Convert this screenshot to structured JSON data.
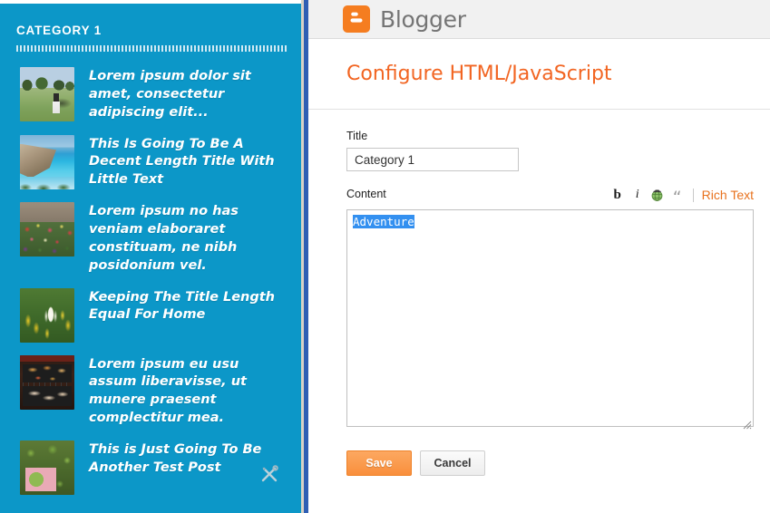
{
  "sidebar": {
    "category_title": "CATEGORY 1",
    "tools_icon": "tools-icon",
    "posts": [
      {
        "title": "Lorem ipsum dolor sit amet, consectetur adipiscing elit...",
        "thumb": "golf-course-photo"
      },
      {
        "title": "This Is Going To Be A Decent Length Title With Little Text",
        "thumb": "beach-cove-photo"
      },
      {
        "title": "Lorem ipsum no has veniam elaboraret constituam, ne nibh posidonium vel.",
        "thumb": "flower-basket-photo"
      },
      {
        "title": "Keeping The Title Length Equal For Home",
        "thumb": "crocus-flowers-photo"
      },
      {
        "title": "Lorem ipsum eu usu assum liberavisse, ut munere praesent complectitur mea.",
        "thumb": "grill-food-photo"
      },
      {
        "title": "This is Just Going To Be Another Test Post",
        "thumb": "fig-fruit-photo"
      }
    ]
  },
  "header": {
    "brand": "Blogger",
    "logo_icon": "blogger-logo-icon"
  },
  "page": {
    "title": "Configure HTML/JavaScript"
  },
  "form": {
    "title_label": "Title",
    "title_value": "Category 1",
    "title_placeholder": "",
    "content_label": "Content",
    "content_value": "Adventure",
    "content_placeholder": "",
    "selected_text": "Adventure"
  },
  "toolbar": {
    "bold_label": "b",
    "italic_label": "i",
    "link_icon": "link-globe-icon",
    "quote_label": "“",
    "rich_text_label": "Rich Text"
  },
  "buttons": {
    "save_label": "Save",
    "cancel_label": "Cancel"
  },
  "colors": {
    "sidebar_blue": "#0c97c8",
    "accent_orange": "#f26522",
    "save_orange": "#f98f3c",
    "selection_blue": "#3390f0",
    "header_gray": "#f1f1f1",
    "window_border_blue": "#2f5fb4"
  }
}
